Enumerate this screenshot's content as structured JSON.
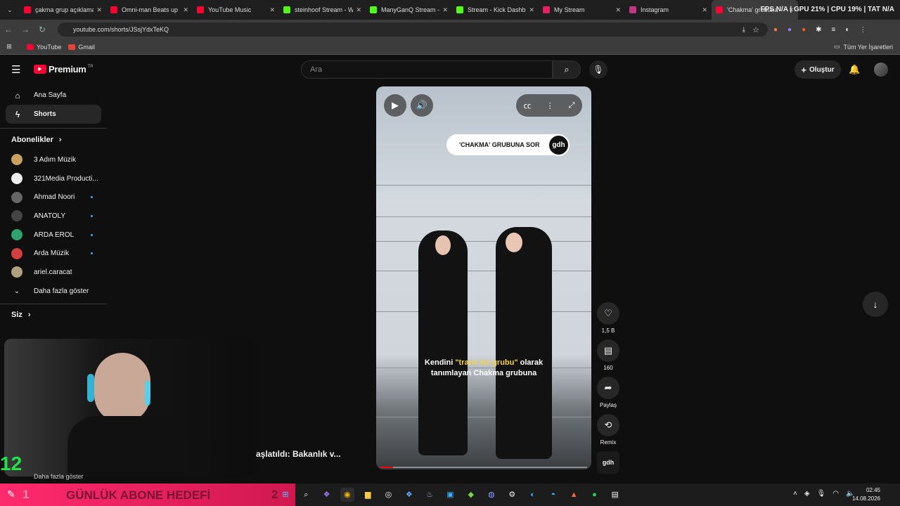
{
  "browser": {
    "tabs": [
      {
        "label": "çakma grup açıklama",
        "color": "#ff0033"
      },
      {
        "label": "Omni-man Beats up",
        "color": "#ff0033"
      },
      {
        "label": "YouTube Music",
        "color": "#ff0033"
      },
      {
        "label": "steinhoof Stream - W",
        "color": "#53fc18"
      },
      {
        "label": "ManyGanQ Stream -",
        "color": "#53fc18"
      },
      {
        "label": "Stream - Kick Dashbo",
        "color": "#53fc18"
      },
      {
        "label": "My Stream",
        "color": "#e91e63"
      },
      {
        "label": "Instagram",
        "color": "#c13584"
      },
      {
        "label": "'Chakma' grubuna",
        "color": "#ff0033"
      }
    ],
    "stats": "FPS N/A | GPU 21% | CPU 19% | TAT N/A",
    "url": "youtube.com/shorts/JSsjYdxTeKQ",
    "bookmarks": [
      {
        "label": "YouTube",
        "color": "#ff0033"
      },
      {
        "label": "Gmail",
        "color": "#ea4335"
      }
    ],
    "all_bookmarks": "Tüm Yer İşaretleri"
  },
  "youtube": {
    "logo_text": "Premium",
    "logo_region": "TR",
    "search_placeholder": "Ara",
    "create_label": "Oluştur",
    "nav": [
      {
        "label": "Ana Sayfa",
        "icon": "home-icon"
      },
      {
        "label": "Shorts",
        "icon": "shorts-icon"
      }
    ],
    "subs_header": "Abonelikler",
    "subscriptions": [
      {
        "name": "3 Adım Müzik",
        "new": false,
        "color": "#c8a060"
      },
      {
        "name": "321Media Producti...",
        "new": false,
        "color": "#eeeeee"
      },
      {
        "name": "Ahmad Noori",
        "new": true,
        "color": "#666666"
      },
      {
        "name": "ANATOLY",
        "new": true,
        "color": "#444444"
      },
      {
        "name": "ARDA EROL",
        "new": true,
        "color": "#2ea36e"
      },
      {
        "name": "Arda Müzik",
        "new": true,
        "color": "#d24040"
      },
      {
        "name": "ariel.caracat",
        "new": false,
        "color": "#b0a080"
      }
    ],
    "show_more": "Daha fazla göster",
    "you_header": "Siz",
    "show_more_bottom": "Daha fazla göster"
  },
  "short": {
    "pill_text": "'CHAKMA' GRUBUNA SOR",
    "channel_badge": "gdh",
    "caption_before": "Kendini ",
    "caption_highlight": "\"trans kız grubu\"",
    "caption_after": " olarak",
    "caption_line2": "tanımlayan Chakma grubuna",
    "progress_fraction": 0.06
  },
  "actions": {
    "like_count": "1,5 B",
    "comment_count": "160",
    "share_label": "Paylaş",
    "remix_label": "Remix",
    "channel_label": "gdh"
  },
  "overlay": {
    "counter": "12",
    "headline": "aşlatıldı: Bakanlık v...",
    "goal_left": "1",
    "goal_text": "GÜNLÜK ABONE HEDEFİ",
    "goal_right": "2"
  },
  "taskbar": {
    "time": "02:45",
    "date": "14.08.2026"
  }
}
